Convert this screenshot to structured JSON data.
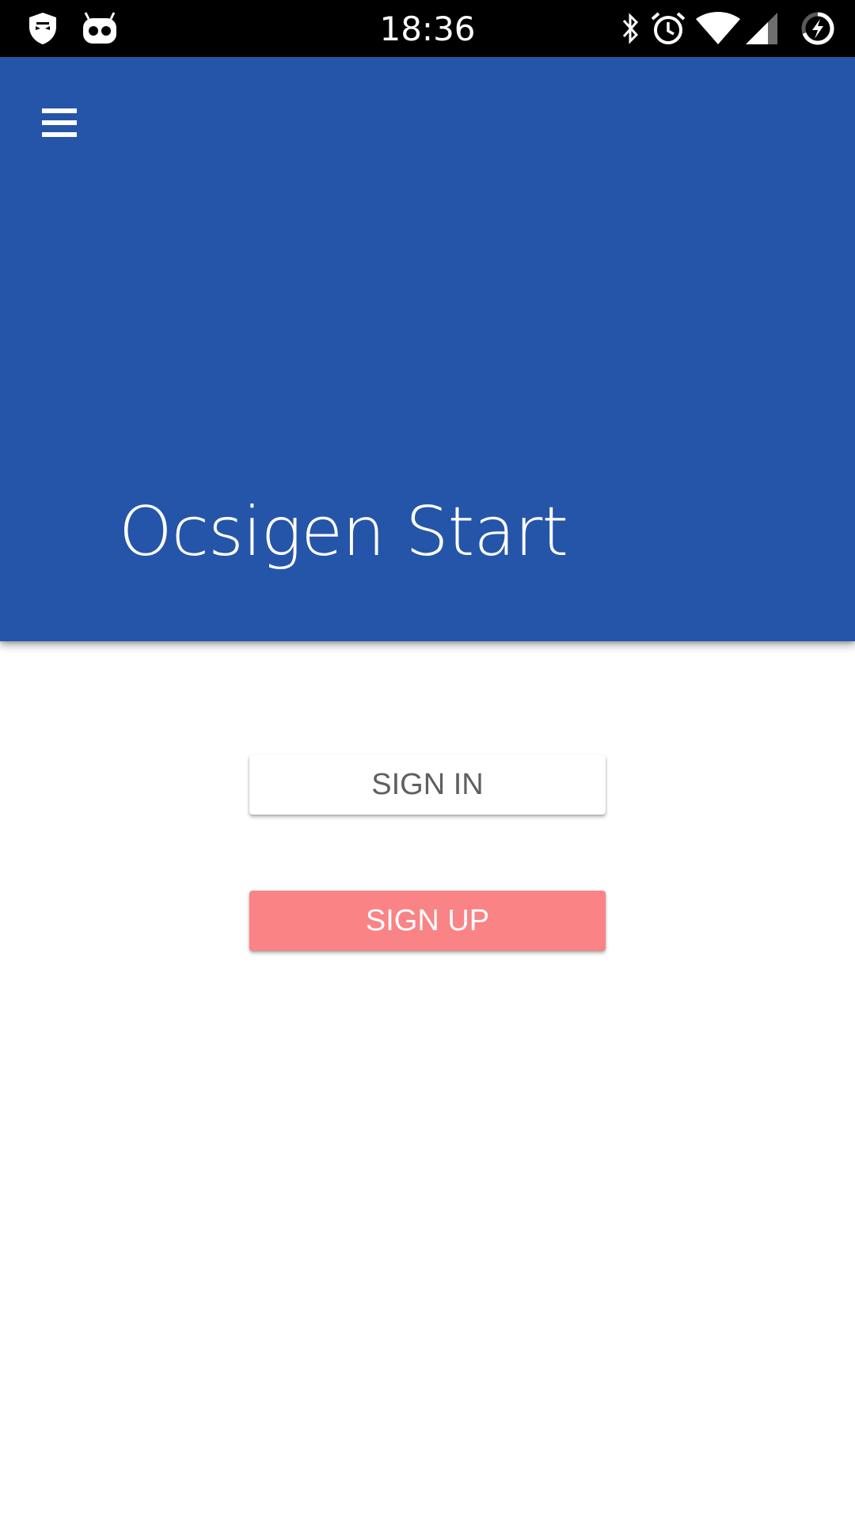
{
  "status_bar": {
    "time": "18:36",
    "left_icons": [
      "privacy-guard-icon",
      "cyanogen-mascot-icon"
    ],
    "right_icons": [
      "bluetooth-icon",
      "alarm-icon",
      "wifi-icon",
      "cell-signal-icon",
      "battery-charging-icon"
    ]
  },
  "app_bar": {
    "title": "Ocsigen Start",
    "menu_icon": "hamburger-menu-icon",
    "background_color": "#2555a8"
  },
  "actions": {
    "sign_in_label": "SIGN IN",
    "sign_up_label": "SIGN UP",
    "sign_up_color": "#f98385"
  }
}
